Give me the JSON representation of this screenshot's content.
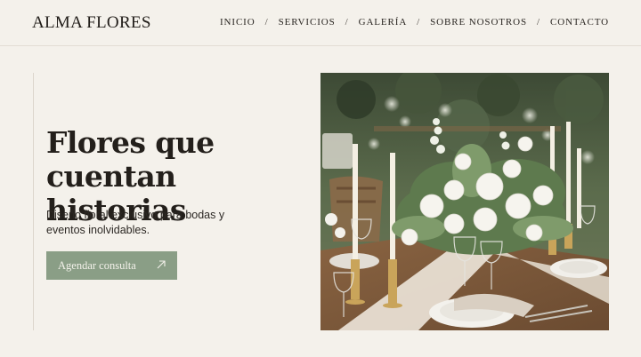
{
  "brand": {
    "name": "ALMA FLORES"
  },
  "nav": {
    "items": [
      {
        "label": "INICIO"
      },
      {
        "label": "SERVICIOS"
      },
      {
        "label": "GALERÍA"
      },
      {
        "label": "SOBRE NOSOTROS"
      },
      {
        "label": "CONTACTO"
      }
    ],
    "separator": "/"
  },
  "hero": {
    "title_line1": "Flores que",
    "title_line2": "cuentan historias",
    "subtitle": "Diseño floral exclusivo para bodas y eventos inolvidables.",
    "cta_label": "Agendar consulta",
    "cta_icon": "arrow-up-right-icon"
  },
  "colors": {
    "background": "#f4f1eb",
    "accent": "#8a9e86",
    "text": "#231f1b"
  }
}
